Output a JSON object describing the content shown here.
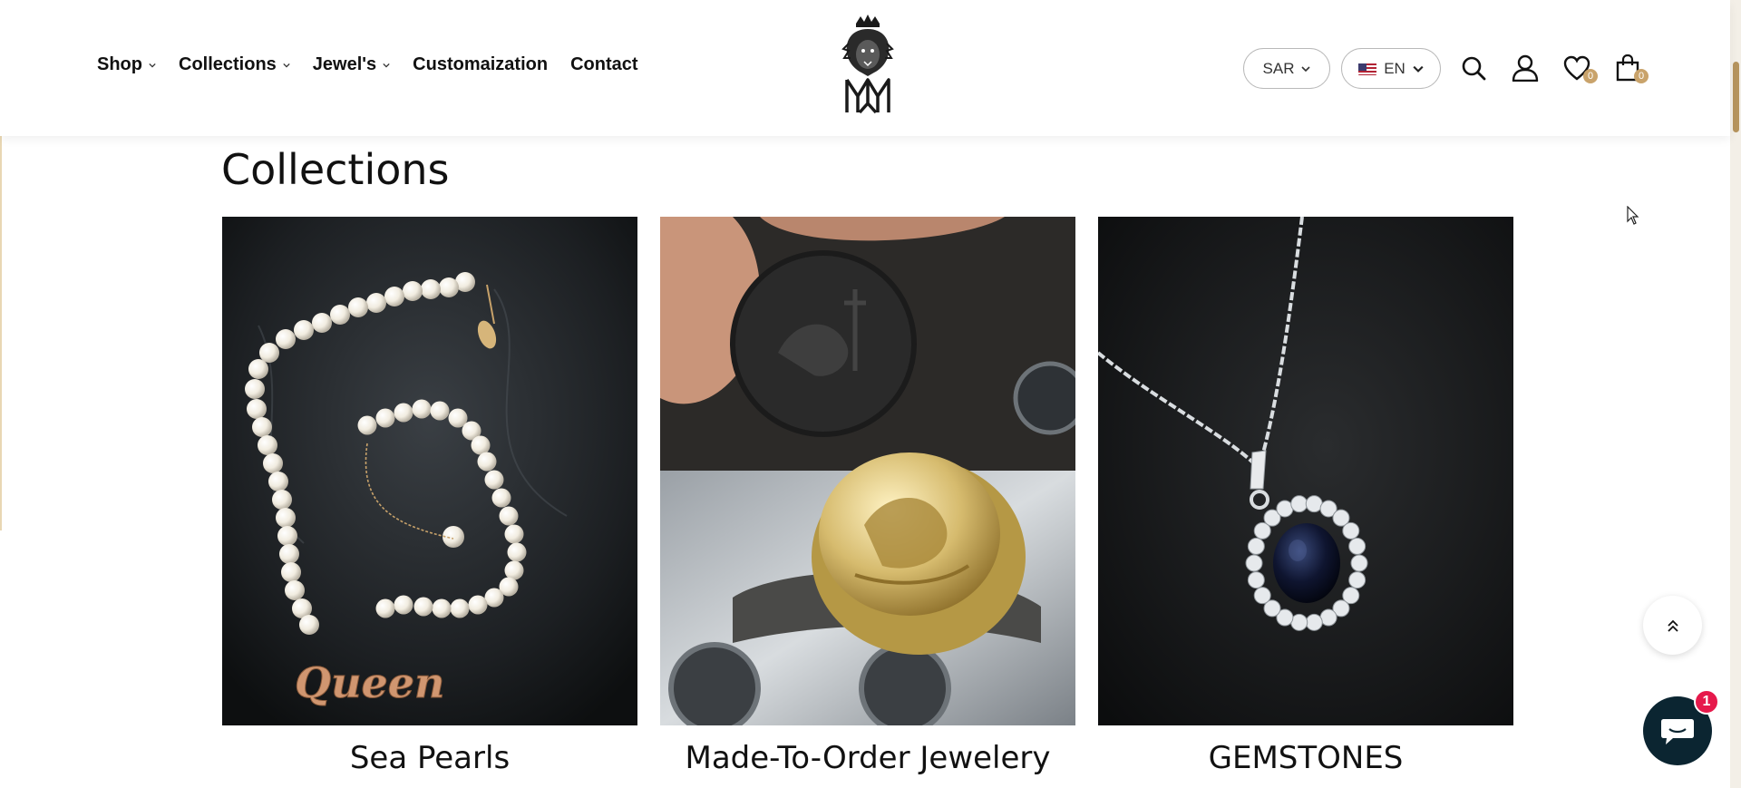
{
  "nav": {
    "items": [
      {
        "label": "Shop",
        "has_dropdown": true
      },
      {
        "label": "Collections",
        "has_dropdown": true
      },
      {
        "label": "Jewel's",
        "has_dropdown": true
      },
      {
        "label": "Customaization",
        "has_dropdown": false
      },
      {
        "label": "Contact",
        "has_dropdown": false
      }
    ]
  },
  "header": {
    "logo_icon": "lion-crown-monogram-logo",
    "currency": "SAR",
    "language": "EN",
    "wishlist_count": "0",
    "cart_count": "0",
    "icons": [
      "search-icon",
      "account-icon",
      "heart-icon",
      "shopping-bag-icon"
    ]
  },
  "main": {
    "title": "Collections",
    "collections": [
      {
        "title": "Sea Pearls",
        "image": "pearl-necklace-photo"
      },
      {
        "title": "Made-To-Order Jewelery",
        "image": "signet-ring-photo"
      },
      {
        "title": "GEMSTONES",
        "image": "sapphire-pendant-photo"
      }
    ]
  },
  "chat": {
    "unread": "1"
  },
  "colors": {
    "accent": "#c9a36b",
    "chat_bg": "#0b2531",
    "chat_badge": "#e6194b"
  }
}
